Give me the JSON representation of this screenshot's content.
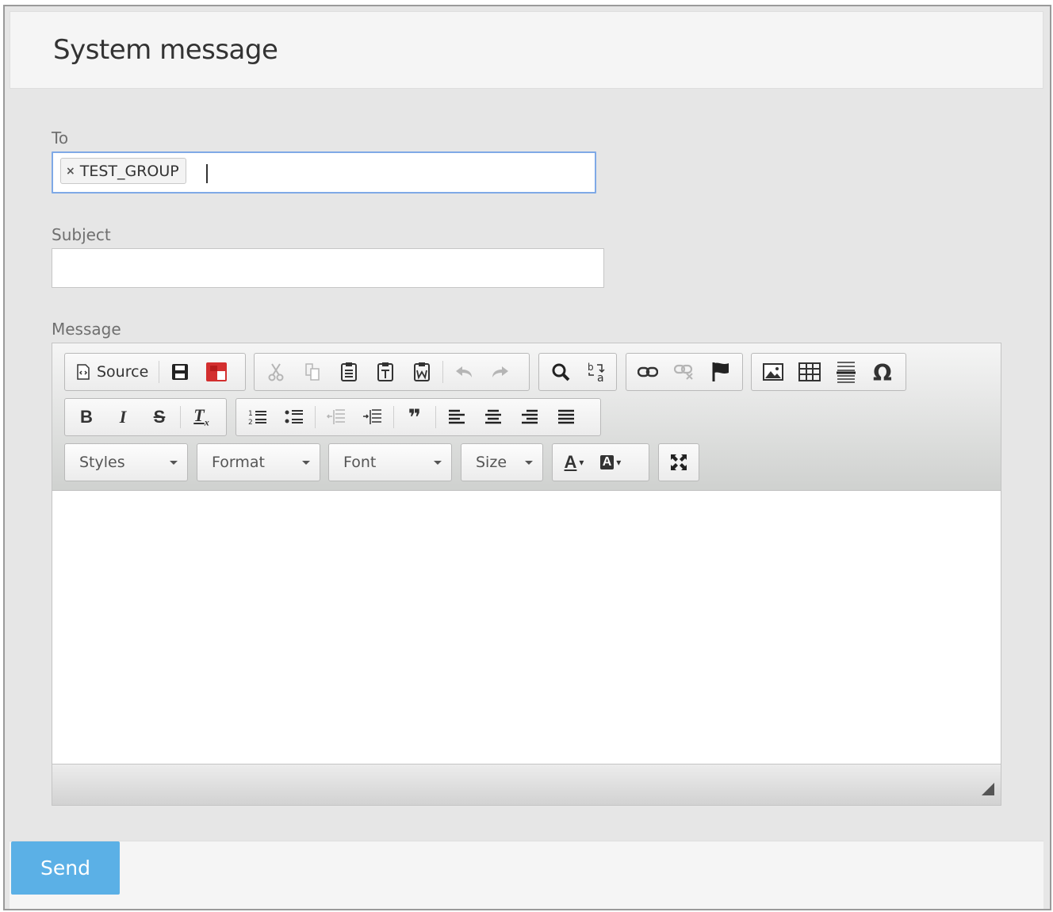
{
  "header": {
    "title": "System message"
  },
  "form": {
    "to_label": "To",
    "to_tags": [
      "TEST_GROUP"
    ],
    "tag_remove_glyph": "×",
    "subject_label": "Subject",
    "subject_value": "",
    "message_label": "Message"
  },
  "toolbar": {
    "source_label": "Source",
    "styles_label": "Styles",
    "format_label": "Format",
    "font_label": "Font",
    "size_label": "Size",
    "bold_glyph": "B",
    "italic_glyph": "I",
    "strike_glyph": "S",
    "removeformat_glyph": "T",
    "removeformat_sub": "x",
    "fontcolor_glyph": "A",
    "bgcolor_glyph": "A",
    "blockquote_glyph": "❞"
  },
  "footer": {
    "send_label": "Send"
  },
  "colors": {
    "accent": "#5bb0e6",
    "focus_border": "#7fa9e6",
    "save_red": "#d32f2f"
  }
}
